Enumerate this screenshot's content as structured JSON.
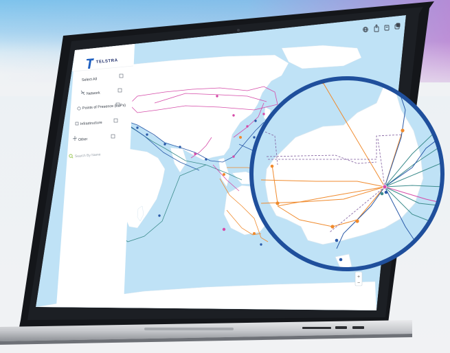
{
  "app": {
    "brand": "TELSTRA"
  },
  "toolbar": {
    "icons": [
      "globe-icon",
      "share-icon",
      "print-icon",
      "layers-icon",
      "fullscreen-icon"
    ]
  },
  "sidebar": {
    "select_all": "Select All",
    "items": [
      {
        "label": "Network",
        "icon": "network-icon"
      },
      {
        "label": "Points of Presence (PoPs)",
        "icon": "pop-icon"
      },
      {
        "label": "Infrastructure",
        "icon": "infrastructure-icon"
      },
      {
        "label": "Other",
        "icon": "other-icon"
      }
    ],
    "search_placeholder": "Search By Name"
  },
  "map": {
    "zoom_controls": [
      "zoom-in",
      "zoom-out"
    ],
    "colors": {
      "ocean": "#bfe2f6",
      "land": "#ffffff",
      "network_pink": "#d54aa8",
      "network_orange": "#f08a2c",
      "network_teal": "#3c8c8c",
      "network_blue": "#2a5aa8",
      "magnifier_border": "#1f4f9c"
    }
  }
}
